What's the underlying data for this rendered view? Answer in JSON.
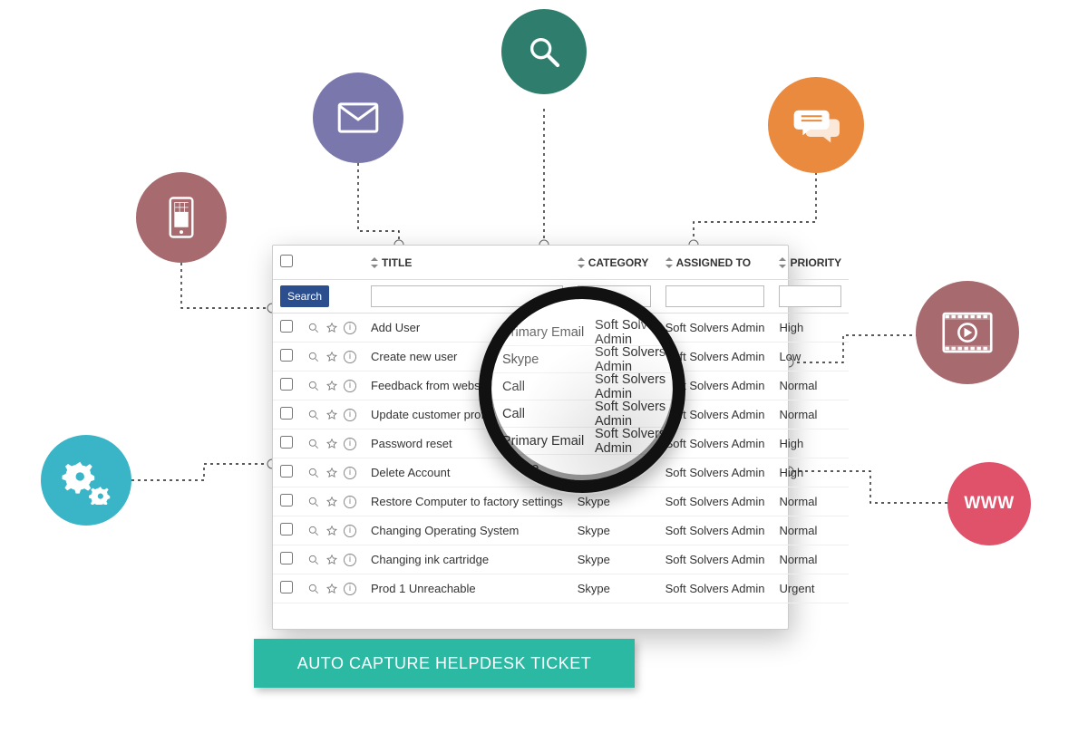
{
  "cta_label": "AUTO CAPTURE HELPDESK TICKET",
  "search_button": "Search",
  "headers": {
    "title": "TITLE",
    "category": "CATEGORY",
    "assigned_to": "ASSIGNED TO",
    "priority": "PRIORITY"
  },
  "rows": [
    {
      "title": "Add User",
      "category": "Primary Email",
      "assigned_to": "Soft Solvers Admin",
      "priority": "High"
    },
    {
      "title": "Create new user",
      "category": "Skype",
      "assigned_to": "Soft Solvers Admin",
      "priority": "Low"
    },
    {
      "title": "Feedback from website",
      "category": "Call",
      "assigned_to": "Soft Solvers Admin",
      "priority": "Normal"
    },
    {
      "title": "Update customer profile",
      "category": "Call",
      "assigned_to": "Soft Solvers Admin",
      "priority": "Normal"
    },
    {
      "title": "Password reset",
      "category": "Primary Email",
      "assigned_to": "Soft Solvers Admin",
      "priority": "High"
    },
    {
      "title": "Delete Account",
      "category": "Skype",
      "assigned_to": "Soft Solvers Admin",
      "priority": "High"
    },
    {
      "title": "Restore Computer to factory settings",
      "category": "Skype",
      "assigned_to": "Soft Solvers Admin",
      "priority": "Normal"
    },
    {
      "title": "Changing Operating System",
      "category": "Skype",
      "assigned_to": "Soft Solvers Admin",
      "priority": "Normal"
    },
    {
      "title": "Changing ink cartridge",
      "category": "Skype",
      "assigned_to": "Soft Solvers Admin",
      "priority": "Normal"
    },
    {
      "title": "Prod 1 Unreachable",
      "category": "Skype",
      "assigned_to": "Soft Solvers Admin",
      "priority": "Urgent"
    }
  ],
  "magnifier_rows": [
    {
      "left": "Primary Email",
      "right": "Soft Solvers Admin"
    },
    {
      "left": "Skype",
      "right": "Soft Solvers Admin"
    },
    {
      "left": "Call",
      "right": "Soft Solvers Admin"
    },
    {
      "left": "Call",
      "right": "Soft Solvers Admin"
    },
    {
      "left": "Primary Email",
      "right": "Soft Solvers Admin"
    },
    {
      "left": "Skype",
      "right": ""
    }
  ],
  "nodes": {
    "www_label": "WWW"
  },
  "colors": {
    "phone": "#a76a6f",
    "email": "#7a77ad",
    "search": "#2f7e6d",
    "chat": "#e98a3e",
    "video": "#a76a6f",
    "gears": "#39b5c7",
    "www": "#e0516a",
    "cta": "#2bb9a4",
    "search_btn": "#2b4e8e"
  }
}
